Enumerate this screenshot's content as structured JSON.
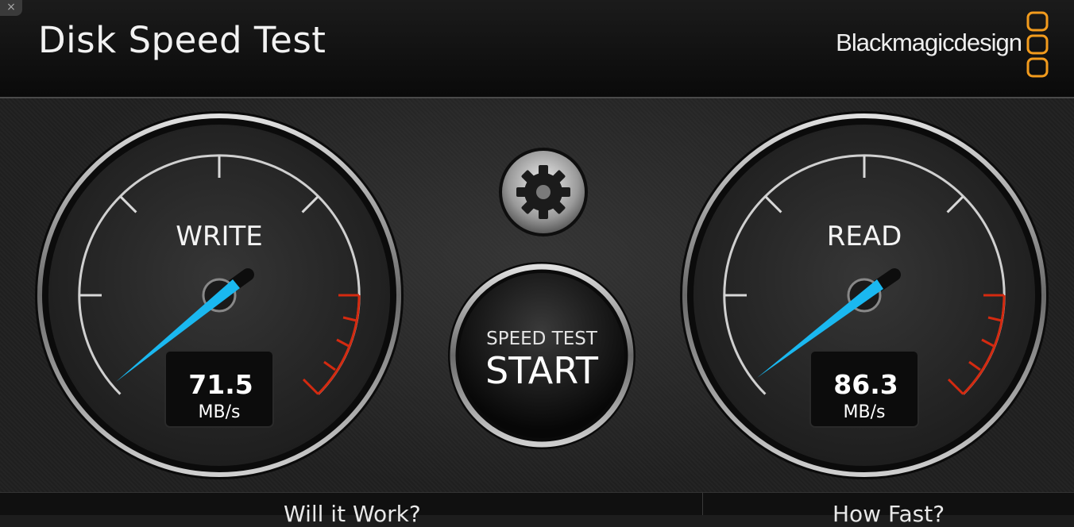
{
  "window": {
    "close_glyph": "×"
  },
  "header": {
    "title": "Disk Speed Test",
    "brand": "Blackmagicdesign",
    "brand_color": "#f29b1d"
  },
  "gauges": {
    "write": {
      "label": "WRITE",
      "value": "71.5",
      "unit": "MB/s"
    },
    "read": {
      "label": "READ",
      "value": "86.3",
      "unit": "MB/s"
    }
  },
  "controls": {
    "settings_icon": "gear-icon",
    "start_caption": "SPEED TEST",
    "start_label": "START"
  },
  "footer": {
    "left_tab": "Will it Work?",
    "right_tab": "How Fast?"
  },
  "colors": {
    "needle": "#1ab8f0",
    "redline": "#d42a10"
  }
}
